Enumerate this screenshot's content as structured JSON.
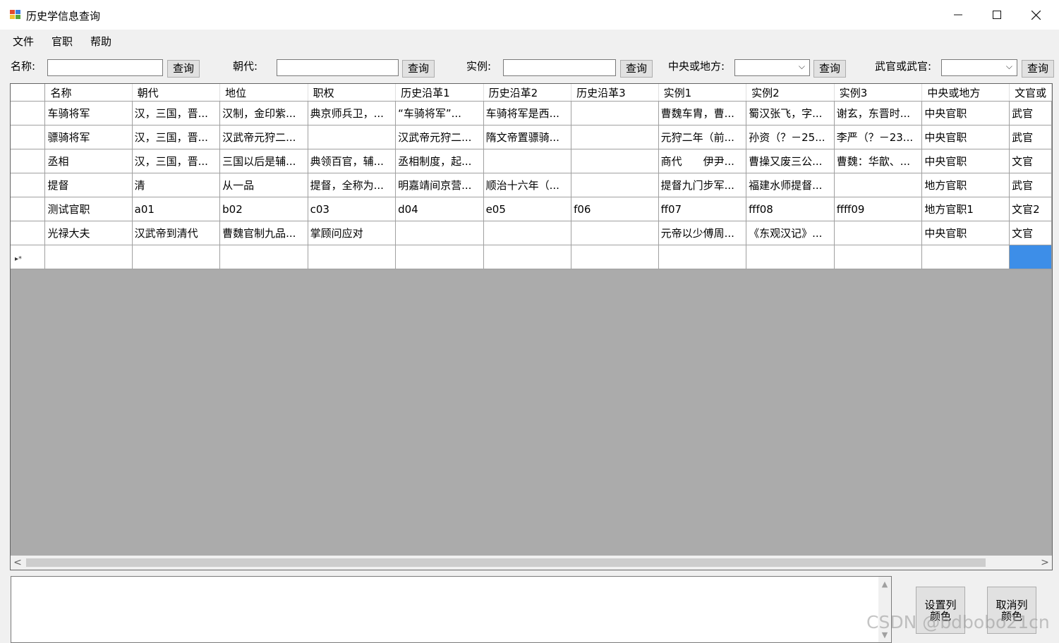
{
  "window": {
    "title": "历史学信息查询",
    "minimize": "—",
    "maximize": "☐",
    "close": "✕"
  },
  "menu": [
    "文件",
    "官职",
    "帮助"
  ],
  "search": {
    "name_label": "名称:",
    "dynasty_label": "朝代:",
    "example_label": "实例:",
    "central_label": "中央或地方:",
    "military_label": "武官或武官:",
    "query_button": "查询"
  },
  "grid": {
    "columns": [
      "名称",
      "朝代",
      "地位",
      "职权",
      "历史沿革1",
      "历史沿革2",
      "历史沿革3",
      "实例1",
      "实例2",
      "实例3",
      "中央或地方",
      "文官或"
    ],
    "rows": [
      [
        "车骑将军",
        "汉，三国，晋...",
        "汉制，金印紫...",
        "典京师兵卫，...",
        "“车骑将军”...",
        "车骑将军是西...",
        "",
        "曹魏车胄，曹...",
        "蜀汉张飞，字...",
        "谢玄，东晋时...",
        "中央官职",
        "武官"
      ],
      [
        "骠骑将军",
        "汉，三国，晋...",
        "汉武帝元狩二...",
        "",
        "汉武帝元狩二...",
        "隋文帝置骠骑...",
        "",
        "元狩二年（前...",
        "孙资（？－25...",
        "李严（？－23...",
        "中央官职",
        "武官"
      ],
      [
        "丞相",
        "汉，三国，晋...",
        "三国以后是辅...",
        "典领百官，辅...",
        "丞相制度，起...",
        "",
        "",
        "商代　　伊尹...",
        "曹操又废三公...",
        "曹魏：华歆、...",
        "中央官职",
        "文官"
      ],
      [
        "提督",
        "清",
        "从一品",
        "提督，全称为...",
        "明嘉靖间京营...",
        "顺治十六年（...",
        "",
        "提督九门步军...",
        "福建水师提督...",
        "",
        "地方官职",
        "武官"
      ],
      [
        "测试官职",
        "a01",
        "b02",
        "c03",
        "d04",
        "e05",
        "f06",
        "ff07",
        "fff08",
        "ffff09",
        "地方官职1",
        "文官2"
      ],
      [
        "光禄大夫",
        "汉武帝到清代",
        "曹魏官制九品...",
        "掌顾问应对",
        "",
        "",
        "",
        "元帝以少傅周...",
        "《东观汉记》...",
        "",
        "中央官职",
        "文官"
      ]
    ],
    "new_row_marker": "▸*",
    "scroll_left": "<",
    "scroll_right": ">"
  },
  "buttons": {
    "set_color": "设置列颜色",
    "cancel_color": "取消列颜色"
  },
  "watermark": "CSDN @bdbobo21cn",
  "colors": {
    "grid_background": "#ababab",
    "selection": "#3d8ee8"
  }
}
